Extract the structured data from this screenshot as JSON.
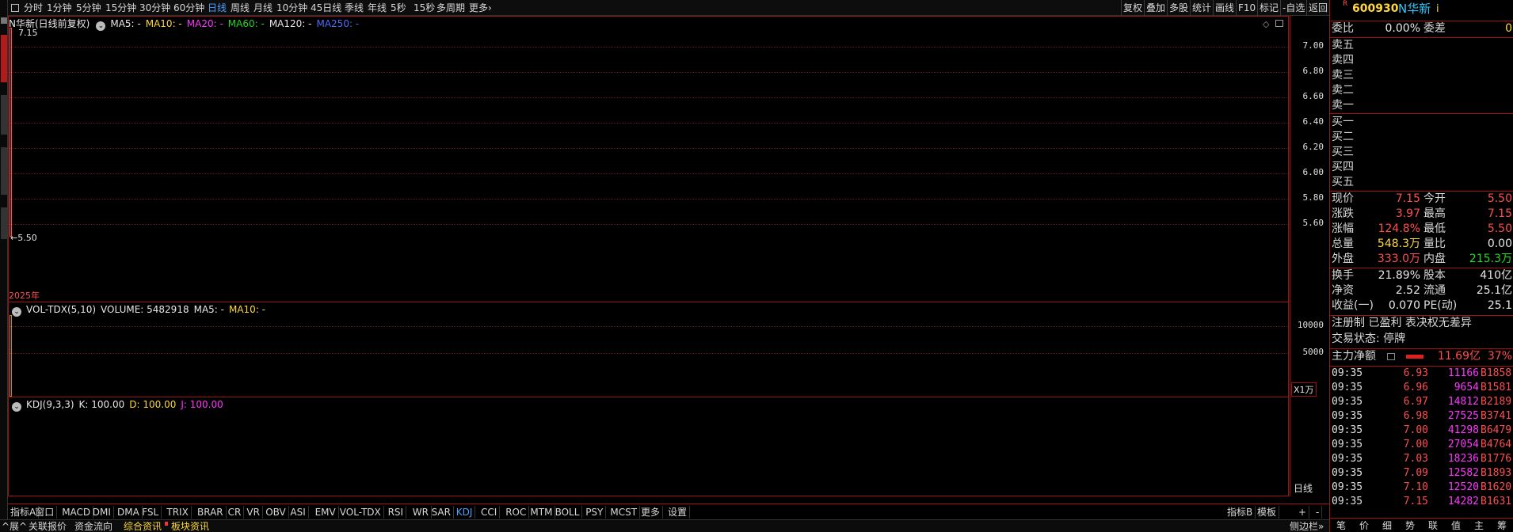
{
  "toolbar": {
    "periods": [
      "分时",
      "1分钟",
      "5分钟",
      "15分钟",
      "30分钟",
      "60分钟",
      "日线",
      "周线",
      "月线",
      "10分钟",
      "45日线",
      "季线",
      "年线",
      "5秒",
      "15秒",
      "多周期",
      "更多"
    ],
    "active_period": "日线",
    "right_buttons": [
      "复权",
      "叠加",
      "多股",
      "统计",
      "画线",
      "F10",
      "标记",
      "-自选",
      "返回"
    ]
  },
  "price_pane": {
    "title": "N华新(日线前复权)",
    "ma": [
      {
        "label": "MA5: -",
        "color": "#e6e6e6"
      },
      {
        "label": "MA10: -",
        "color": "#ffd838"
      },
      {
        "label": "MA20: -",
        "color": "#ff36ff"
      },
      {
        "label": "MA60: -",
        "color": "#22d822"
      },
      {
        "label": "MA120: -",
        "color": "#e6e6e6"
      },
      {
        "label": "MA250: -",
        "color": "#4b6dff"
      }
    ],
    "high_label": "7.15",
    "low_label": "←5.50",
    "ticks": [
      "7.00",
      "6.80",
      "6.60",
      "6.40",
      "6.20",
      "6.00",
      "5.80",
      "5.60"
    ],
    "candle": {
      "open": 5.5,
      "high": 7.15,
      "low": 5.5,
      "close": 7.15
    },
    "year_label": "2025年"
  },
  "vol_pane": {
    "indicator": "VOL-TDX(5,10)",
    "volume": "VOLUME: 5482918",
    "ma5": "MA5: -",
    "ma10": "MA10: -",
    "ticks": [
      "10000",
      "5000"
    ],
    "unit": "X1万",
    "bar_value": 5482918
  },
  "kdj_pane": {
    "indicator": "KDJ(9,3,3)",
    "k": "K: 100.00",
    "d": "D: 100.00",
    "j": "J: 100.00",
    "period_label": "日线"
  },
  "indicator_tabs": [
    "指标A",
    "窗口",
    "MACD",
    "DMI",
    "DMA",
    "FSL",
    "TRIX",
    "BRAR",
    "CR",
    "VR",
    "OBV",
    "ASI",
    "EMV",
    "VOL-TDX",
    "RSI",
    "WR",
    "SAR",
    "KDJ",
    "CCI",
    "ROC",
    "MTM",
    "BOLL",
    "PSY",
    "MCST",
    "更多",
    "设置"
  ],
  "active_indicator": "KDJ",
  "indicator_right": [
    "指标B",
    "模板",
    "+",
    "-"
  ],
  "info_tabs": [
    "^展^",
    "关联报价",
    "资金流向",
    "综合资讯",
    "板块资讯"
  ],
  "right_panel": {
    "code": "600930",
    "name": "N华新",
    "weibi_label": "委比",
    "weibi_value": "0.00%",
    "weicha_label": "委差",
    "weicha_value": "0",
    "sell_levels": [
      "卖五",
      "卖四",
      "卖三",
      "卖二",
      "卖一"
    ],
    "buy_levels": [
      "买一",
      "买二",
      "买三",
      "买四",
      "买五"
    ],
    "quote": [
      {
        "l1": "现价",
        "v1": "7.15",
        "c1": "#ff4e4e",
        "l2": "今开",
        "v2": "5.50",
        "c2": "#ff4e4e"
      },
      {
        "l1": "涨跌",
        "v1": "3.97",
        "c1": "#ff4e4e",
        "l2": "最高",
        "v2": "7.15",
        "c2": "#ff4e4e"
      },
      {
        "l1": "涨幅",
        "v1": "124.8%",
        "c1": "#ff4e4e",
        "l2": "最低",
        "v2": "5.50",
        "c2": "#ff4e4e"
      },
      {
        "l1": "总量",
        "v1": "548.3万",
        "c1": "#ffd838",
        "l2": "量比",
        "v2": "0.00",
        "c2": "#e6e6e6"
      },
      {
        "l1": "外盘",
        "v1": "333.0万",
        "c1": "#ff4e4e",
        "l2": "内盘",
        "v2": "215.3万",
        "c2": "#22d822"
      }
    ],
    "stats": [
      {
        "l1": "换手",
        "v1": "21.89%",
        "l2": "股本",
        "v2": "410亿"
      },
      {
        "l1": "净资",
        "v1": "2.52",
        "l2": "流通",
        "v2": "25.1亿"
      },
      {
        "l1": "收益(一)",
        "v1": "0.070",
        "l2": "PE(动)",
        "v2": "25.1"
      }
    ],
    "tags": "注册制 已盈利 表决权无差异",
    "trade_status": "交易状态: 停牌",
    "main_net_label": "主力净额",
    "main_net_value": "11.69亿",
    "main_net_pct": "37%",
    "ticks": [
      {
        "t": "09:35",
        "p": "6.93",
        "v": "11166",
        "b": "B1858"
      },
      {
        "t": "09:35",
        "p": "6.96",
        "v": "9654",
        "b": "B1581"
      },
      {
        "t": "09:35",
        "p": "6.97",
        "v": "14812",
        "b": "B2189"
      },
      {
        "t": "09:35",
        "p": "6.98",
        "v": "27525",
        "b": "B3741"
      },
      {
        "t": "09:35",
        "p": "7.00",
        "v": "41298",
        "b": "B6479"
      },
      {
        "t": "09:35",
        "p": "7.00",
        "v": "27054",
        "b": "B4764"
      },
      {
        "t": "09:35",
        "p": "7.03",
        "v": "18236",
        "b": "B1776"
      },
      {
        "t": "09:35",
        "p": "7.09",
        "v": "12582",
        "b": "B1893"
      },
      {
        "t": "09:35",
        "p": "7.10",
        "v": "12520",
        "b": "B1620"
      },
      {
        "t": "09:35",
        "p": "7.15",
        "v": "14282",
        "b": "B1631"
      }
    ],
    "bottom_tabs": [
      "笔",
      "价",
      "细",
      "势",
      "联",
      "值",
      "主",
      "筹"
    ]
  },
  "colors": {
    "frame": "#a01212",
    "up": "#ff4e4e",
    "down": "#22d822",
    "accent": "#4ea0ff"
  }
}
